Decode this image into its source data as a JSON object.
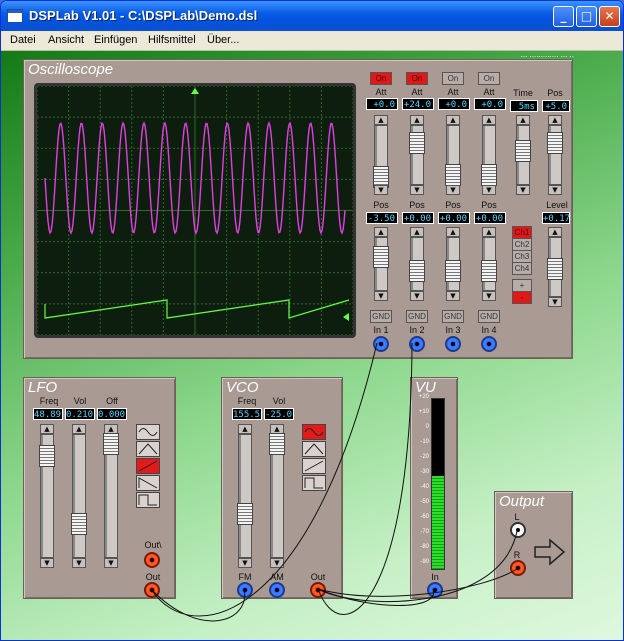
{
  "window": {
    "title": "DSPLab V1.01 - C:\\DSPLab\\Demo.dsl"
  },
  "menu": [
    "Datei",
    "Ansicht",
    "Einfügen",
    "Hilfsmittel",
    "Über..."
  ],
  "oscilloscope": {
    "title": "Oscilloscope",
    "channels": [
      {
        "on_label": "On",
        "att_label": "Att",
        "att_value": "+0.0",
        "pos_label": "Pos",
        "pos_value": "-3.50",
        "gnd_label": "GND",
        "input_label": "In 1",
        "on": true
      },
      {
        "on_label": "On",
        "att_label": "Att",
        "att_value": "+24.0",
        "pos_label": "Pos",
        "pos_value": "+0.00",
        "gnd_label": "GND",
        "input_label": "In 2",
        "on": true
      },
      {
        "on_label": "On",
        "att_label": "Att",
        "att_value": "+0.0",
        "pos_label": "Pos",
        "pos_value": "+0.00",
        "gnd_label": "GND",
        "input_label": "In 3",
        "on": false
      },
      {
        "on_label": "On",
        "att_label": "Att",
        "att_value": "+0.0",
        "pos_label": "Pos",
        "pos_value": "+0.00",
        "gnd_label": "GND",
        "input_label": "In 4",
        "on": false
      }
    ],
    "time_label": "Time",
    "time_value": "5ms",
    "hpos_label": "Pos",
    "hpos_value": "+5.0",
    "level_label": "Level",
    "level_value": "+0.17",
    "trigger_channels": [
      "Ch1",
      "Ch2",
      "Ch3",
      "Ch4"
    ],
    "plus": "+",
    "minus": "-",
    "top_text": "... ............. ... .."
  },
  "lfo": {
    "title": "LFO",
    "freq_label": "Freq",
    "freq_value": "48.89",
    "vol_label": "Vol",
    "vol_value": "0.210",
    "off_label": "Off",
    "off_value": "0.000",
    "out_inv_label": "Out\\",
    "out_label": "Out"
  },
  "vco": {
    "title": "VCO",
    "freq_label": "Freq",
    "freq_value": "155.5",
    "vol_label": "Vol",
    "vol_value": "-25.0",
    "fm_label": "FM",
    "am_label": "AM",
    "out_label": "Out"
  },
  "vu": {
    "title": "VU",
    "scale": [
      "+20",
      "+10",
      "0",
      "-10",
      "-20",
      "-30",
      "-40",
      "-50",
      "-60",
      "-70",
      "-80",
      "-90"
    ],
    "in_label": "In",
    "level_fraction": 0.55
  },
  "output": {
    "title": "Output",
    "l_label": "L",
    "r_label": "R"
  },
  "colors": {
    "trace1": "#e040e0",
    "trace2": "#60ff40",
    "grid": "#2e6a2e",
    "panel": "#a99a94"
  }
}
